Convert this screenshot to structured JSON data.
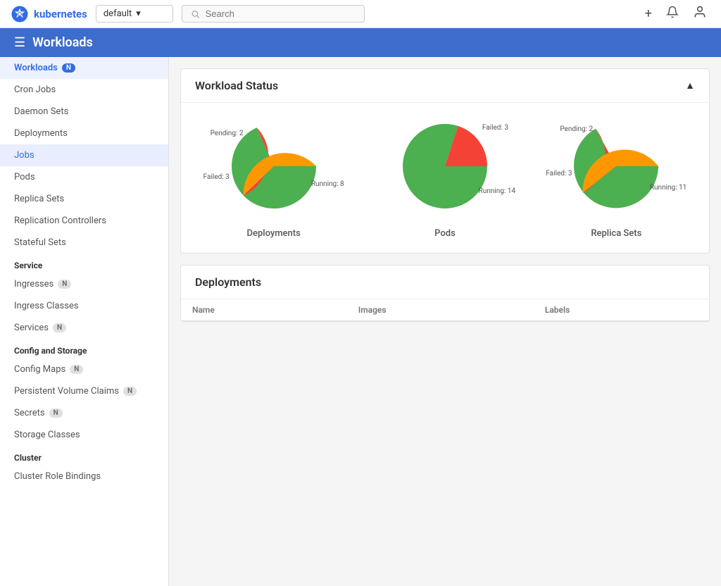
{
  "topbar": {
    "logo_text": "kubernetes",
    "namespace": "default",
    "search_placeholder": "Search",
    "add_icon": "+",
    "bell_icon": "🔔",
    "user_icon": "👤"
  },
  "section_header": {
    "title": "Workloads"
  },
  "sidebar": {
    "workloads_label": "Workloads",
    "workloads_badge": "N",
    "items_workloads": [
      {
        "label": "Cron Jobs",
        "active": false
      },
      {
        "label": "Daemon Sets",
        "active": false
      },
      {
        "label": "Deployments",
        "active": false
      },
      {
        "label": "Jobs",
        "active": true
      },
      {
        "label": "Pods",
        "active": false
      },
      {
        "label": "Replica Sets",
        "active": false
      },
      {
        "label": "Replication Controllers",
        "active": false
      },
      {
        "label": "Stateful Sets",
        "active": false
      }
    ],
    "service_label": "Service",
    "items_service": [
      {
        "label": "Ingresses",
        "badge": "N"
      },
      {
        "label": "Ingress Classes",
        "badge": null
      },
      {
        "label": "Services",
        "badge": "N"
      }
    ],
    "config_label": "Config and Storage",
    "items_config": [
      {
        "label": "Config Maps",
        "badge": "N"
      },
      {
        "label": "Persistent Volume Claims",
        "badge": "N"
      },
      {
        "label": "Secrets",
        "badge": "N"
      },
      {
        "label": "Storage Classes",
        "badge": null
      }
    ],
    "cluster_label": "Cluster",
    "items_cluster": [
      {
        "label": "Cluster Role Bindings",
        "badge": null
      }
    ]
  },
  "workload_status": {
    "title": "Workload Status",
    "charts": [
      {
        "id": "deployments",
        "label": "Deployments",
        "pending": 2,
        "failed": 3,
        "running": 8
      },
      {
        "id": "pods",
        "label": "Pods",
        "pending": 0,
        "failed": 3,
        "running": 14
      },
      {
        "id": "replicasets",
        "label": "Replica Sets",
        "pending": 2,
        "failed": 3,
        "running": 11
      }
    ]
  },
  "deployments_section": {
    "title": "Deployments",
    "columns": [
      "Name",
      "Images",
      "Labels"
    ]
  }
}
